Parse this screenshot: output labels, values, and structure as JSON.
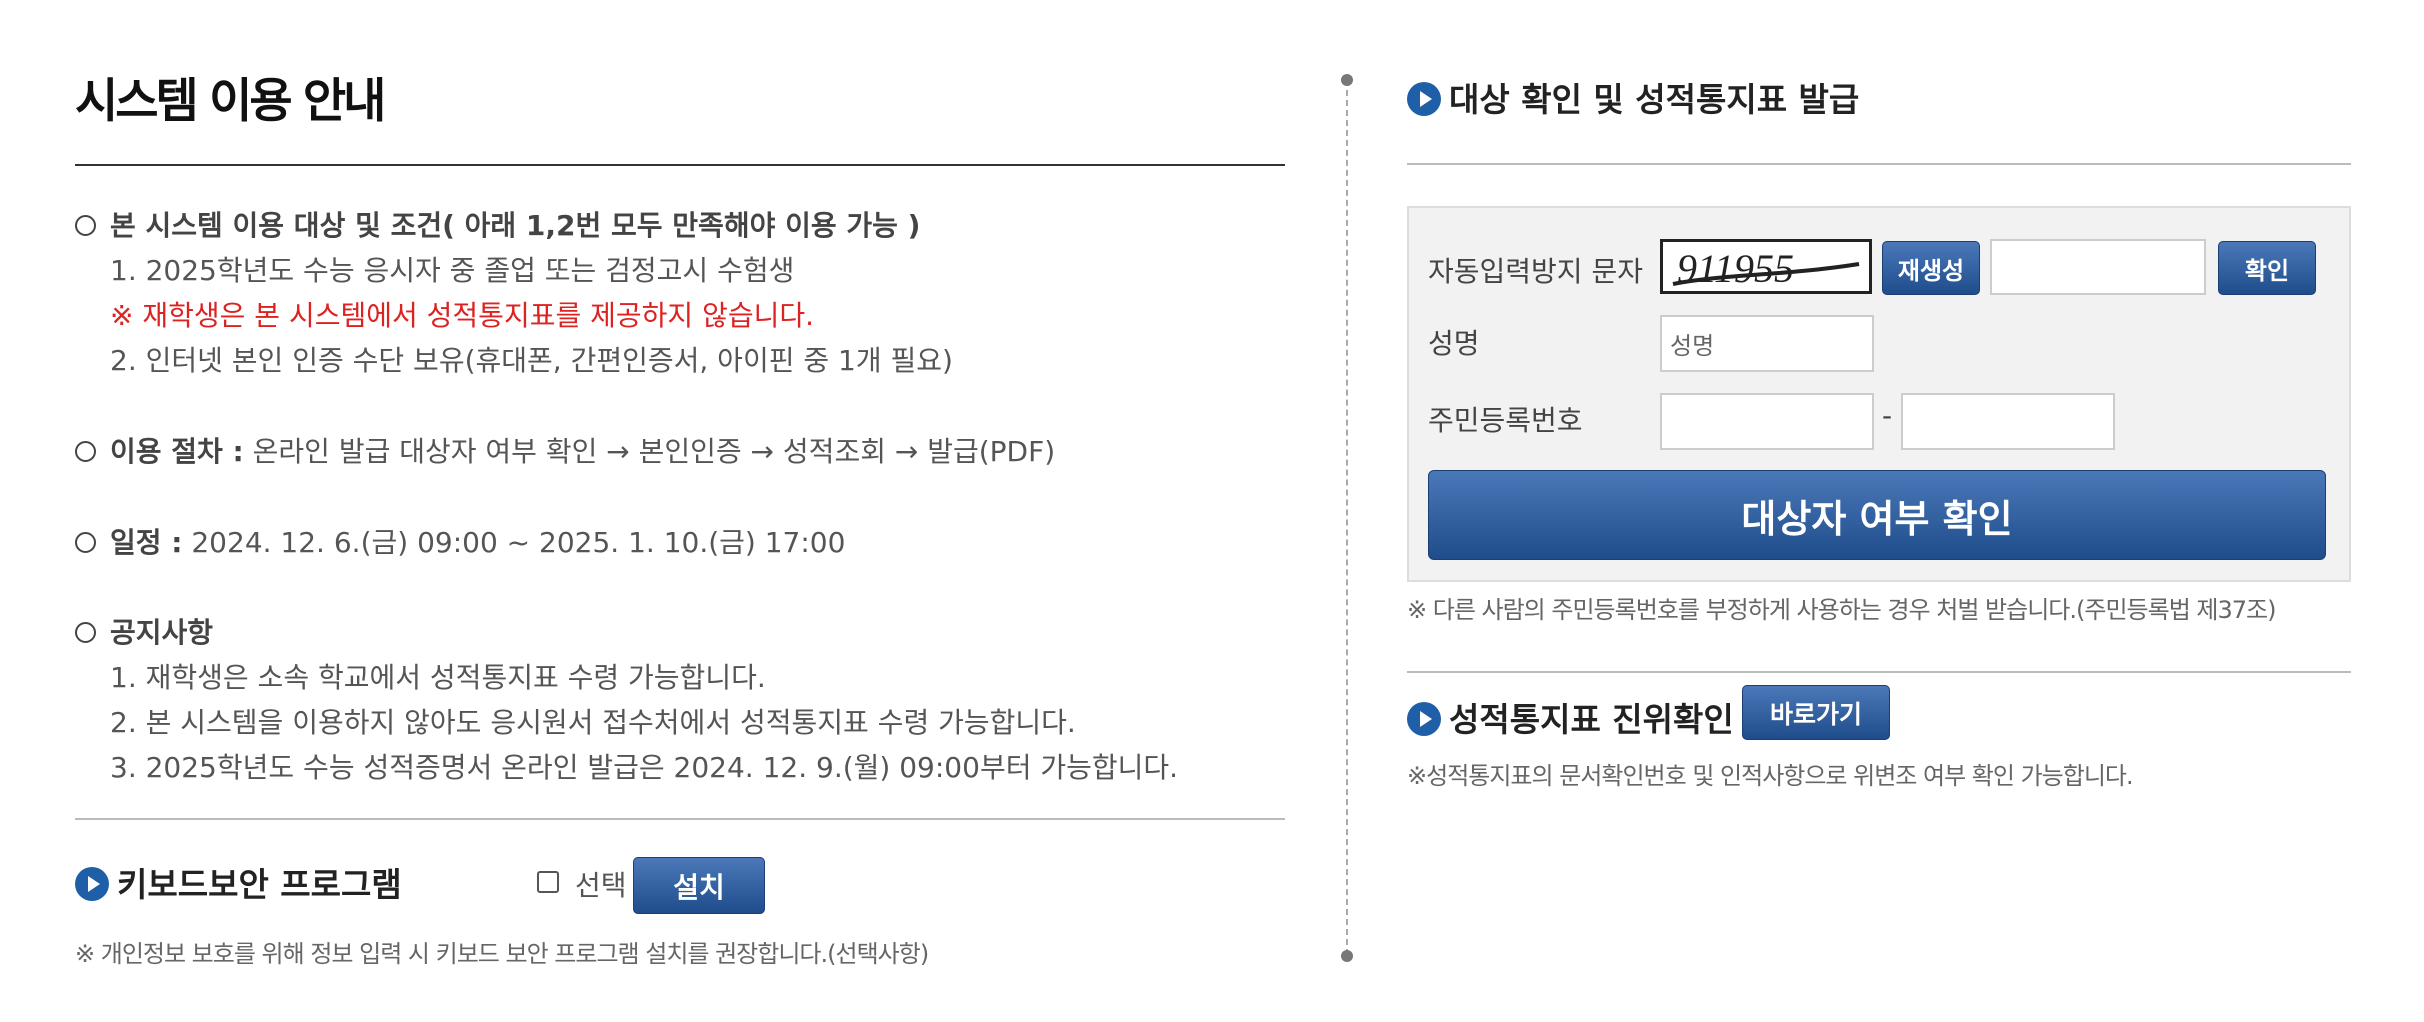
{
  "guide": {
    "title": "시스템 이용 안내",
    "target_heading": "본 시스템 이용 대상 및 조건( 아래 1,2번 모두 만족해야 이용 가능 )",
    "target_items": [
      "1. 2025학년도 수능 응시자 중 졸업 또는 검정고시 수험생",
      "※ 재학생은 본 시스템에서 성적통지표를 제공하지 않습니다.",
      "2. 인터넷 본인 인증 수단 보유(휴대폰, 간편인증서, 아이핀 중 1개 필요)"
    ],
    "procedure_label": "이용 절차 :",
    "procedure_text": " 온라인 발급 대상자 여부 확인 → 본인인증 → 성적조회 → 발급(PDF)",
    "schedule_label": "일정 :",
    "schedule_text": " 2024. 12. 6.(금) 09:00 ~ 2025. 1. 10.(금) 17:00",
    "notice_heading": "공지사항",
    "notice_items": [
      "1. 재학생은 소속 학교에서 성적통지표 수령 가능합니다.",
      "2. 본 시스템을 이용하지 않아도 응시원서 접수처에서 성적통지표 수령 가능합니다.",
      "3. 2025학년도 수능 성적증명서 온라인 발급은 2024. 12. 9.(월) 09:00부터 가능합니다."
    ]
  },
  "keyboard": {
    "title": "키보드보안 프로그램",
    "checkbox_label": "선택",
    "install_label": "설치",
    "note": "※ 개인정보 보호를 위해 정보 입력 시 키보드 보안 프로그램 설치를 권장합니다.(선택사항)"
  },
  "issue": {
    "title": "대상 확인 및 성적통지표 발급",
    "captcha_label": "자동입력방지 문자",
    "captcha_text": "911955",
    "regen_label": "재생성",
    "confirm_label": "확인",
    "name_label": "성명",
    "name_placeholder": "성명",
    "rrn_label": "주민등록번호",
    "rrn_sep": "-",
    "check_button": "대상자 여부 확인",
    "warning": "※ 다른 사람의 주민등록번호를 부정하게 사용하는 경우 처벌 받습니다.(주민등록법 제37조)"
  },
  "verify": {
    "title": "성적통지표 진위확인",
    "go_label": "바로가기",
    "note": "※성적통지표의 문서확인번호 및 인적사항으로 위변조 여부 확인 가능합니다."
  },
  "colors": {
    "accent": "#1f5fa8",
    "warning": "#dd2222"
  }
}
